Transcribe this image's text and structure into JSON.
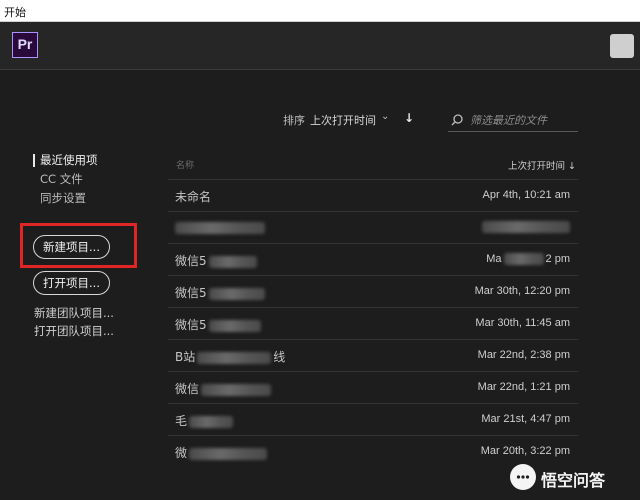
{
  "window": {
    "title": "开始"
  },
  "app": {
    "logo_text": "Pr"
  },
  "sort": {
    "label": "排序",
    "value": "上次打开时间"
  },
  "filter": {
    "placeholder": "筛选最近的文件"
  },
  "sidebar": {
    "nav": [
      {
        "label": "最近使用项",
        "active": true
      },
      {
        "label": "CC 文件",
        "active": false
      },
      {
        "label": "同步设置",
        "active": false
      }
    ],
    "new_project": "新建项目...",
    "open_project": "打开项目...",
    "new_team_project": "新建团队项目...",
    "open_team_project": "打开团队项目..."
  },
  "table": {
    "col_name": "名称",
    "col_date": "上次打开时间 ↓",
    "rows": [
      {
        "name_visible": "未命名",
        "name_suffix": "",
        "date": "Apr 4th, 10:21 am"
      },
      {
        "name_visible": "",
        "name_suffix": "",
        "date": ""
      },
      {
        "name_visible": "微信5",
        "name_suffix": "",
        "date_prefix": "Ma",
        "date": "2 pm"
      },
      {
        "name_visible": "微信5",
        "name_suffix": "",
        "date": "Mar 30th, 12:20 pm"
      },
      {
        "name_visible": "微信5",
        "name_suffix": "",
        "date": "Mar 30th, 11:45 am"
      },
      {
        "name_visible": "B站",
        "name_suffix": "线",
        "date": "Mar 22nd, 2:38 pm"
      },
      {
        "name_visible": "微信",
        "name_suffix": "",
        "date": "Mar 22nd, 1:21 pm"
      },
      {
        "name_visible": "毛",
        "name_suffix": "",
        "date": "Mar 21st, 4:47 pm"
      },
      {
        "name_visible": "微",
        "name_suffix": "",
        "date": "Mar 20th, 3:22 pm"
      }
    ]
  },
  "watermark": {
    "text": "悟空问答"
  },
  "colors": {
    "highlight": "#e02525",
    "logo_border": "#a993ff"
  }
}
